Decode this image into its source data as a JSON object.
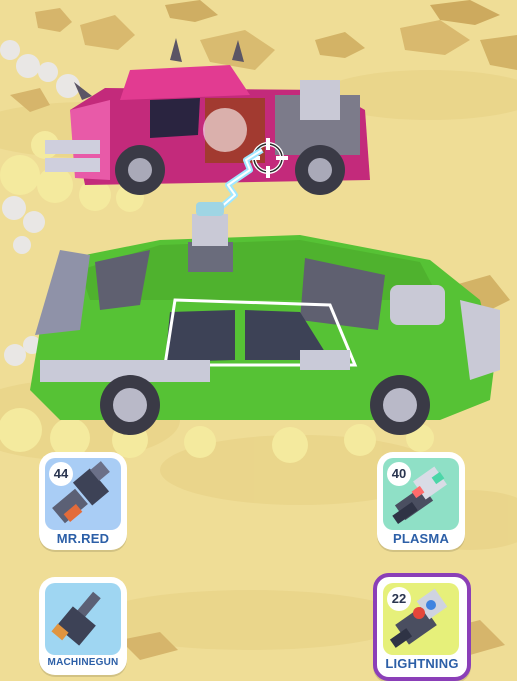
{
  "weapons": [
    {
      "id": "mrred",
      "name": "MR.RED",
      "count": "44",
      "panel_color": "#a9cdf5",
      "selected": false
    },
    {
      "id": "plasma",
      "name": "PLASMA",
      "count": "40",
      "panel_color": "#8fe0c6",
      "selected": false
    },
    {
      "id": "machinegun",
      "name": "MACHINEGUN",
      "count": "",
      "panel_color": "#9fd6f2",
      "selected": false
    },
    {
      "id": "lightning",
      "name": "LIGHTNING",
      "count": "22",
      "panel_color": "#e6f07a",
      "selected": true
    }
  ],
  "colors": {
    "sand": "#efdd96",
    "player_car": "#5cd33a",
    "enemy_car": "#e23b91",
    "selected_border": "#8b3fb8",
    "lightning": "#9fe7ff"
  },
  "icons": [
    "crosshair-icon",
    "rocket-launcher-icon",
    "plasma-gun-icon",
    "machinegun-icon",
    "lightning-gun-icon"
  ]
}
